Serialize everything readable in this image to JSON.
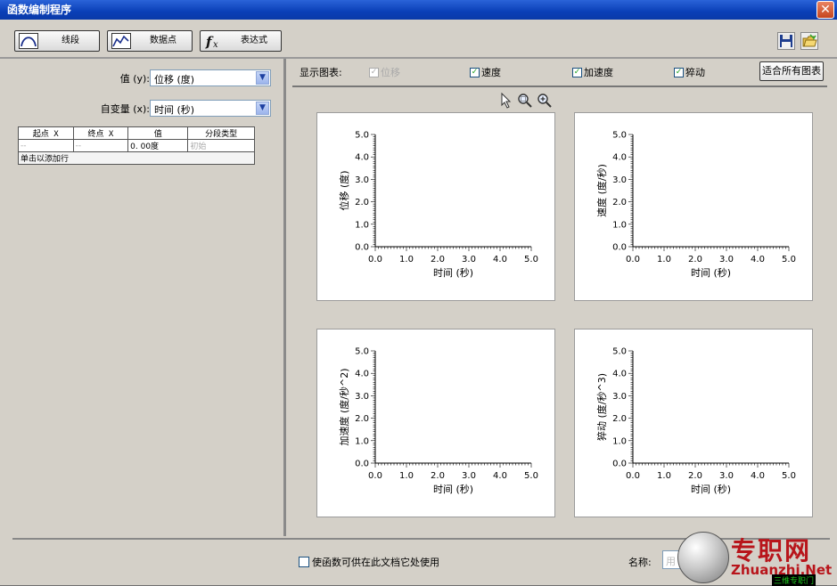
{
  "window": {
    "title": "函数编制程序",
    "close_glyph": "✕"
  },
  "toolbar": {
    "segment_label": "线段",
    "datapoint_label": "数据点",
    "expression_label": "表达式"
  },
  "left": {
    "value_label": "值 (y):",
    "value_selected": "位移 (度)",
    "indep_label": "自变量 (x):",
    "indep_selected": "时间 (秒)",
    "table": {
      "headers": [
        "起点 X",
        "终点 X",
        "值",
        "分段类型"
      ],
      "row": [
        "--",
        "--",
        "0. 00度",
        "初始"
      ],
      "add_row": "单击以添加行"
    }
  },
  "showbar": {
    "label": "显示图表:",
    "items": [
      {
        "label": "位移",
        "checked": true,
        "enabled": false
      },
      {
        "label": "速度",
        "checked": true,
        "enabled": true
      },
      {
        "label": "加速度",
        "checked": true,
        "enabled": true
      },
      {
        "label": "猝动",
        "checked": true,
        "enabled": true
      }
    ],
    "fit_button": "适合所有图表"
  },
  "charts": {
    "xlabel": "时间 (秒)",
    "ticks": [
      "0.0",
      "1.0",
      "2.0",
      "3.0",
      "4.0",
      "5.0"
    ]
  },
  "chart_data": [
    {
      "type": "line",
      "title": "",
      "xlabel": "时间 (秒)",
      "ylabel": "位移 (度)",
      "xlim": [
        0,
        5
      ],
      "ylim": [
        0,
        5
      ],
      "series": []
    },
    {
      "type": "line",
      "title": "",
      "xlabel": "时间 (秒)",
      "ylabel": "速度 (度/秒)",
      "xlim": [
        0,
        5
      ],
      "ylim": [
        0,
        5
      ],
      "series": []
    },
    {
      "type": "line",
      "title": "",
      "xlabel": "时间 (秒)",
      "ylabel": "加速度 (度/秒^2)",
      "xlim": [
        0,
        5
      ],
      "ylim": [
        0,
        5
      ],
      "series": []
    },
    {
      "type": "line",
      "title": "",
      "xlabel": "时间 (秒)",
      "ylabel": "猝动 (度/秒^3)",
      "xlim": [
        0,
        5
      ],
      "ylim": [
        0,
        5
      ],
      "series": []
    }
  ],
  "bottom": {
    "reuse_label": "使函数可供在此文档它处使用",
    "name_label": "名称:",
    "name_placeholder": "用"
  },
  "watermark": {
    "cn": "专职网",
    "en": "Zhuanzhi.Net",
    "small": "三维专职门"
  }
}
